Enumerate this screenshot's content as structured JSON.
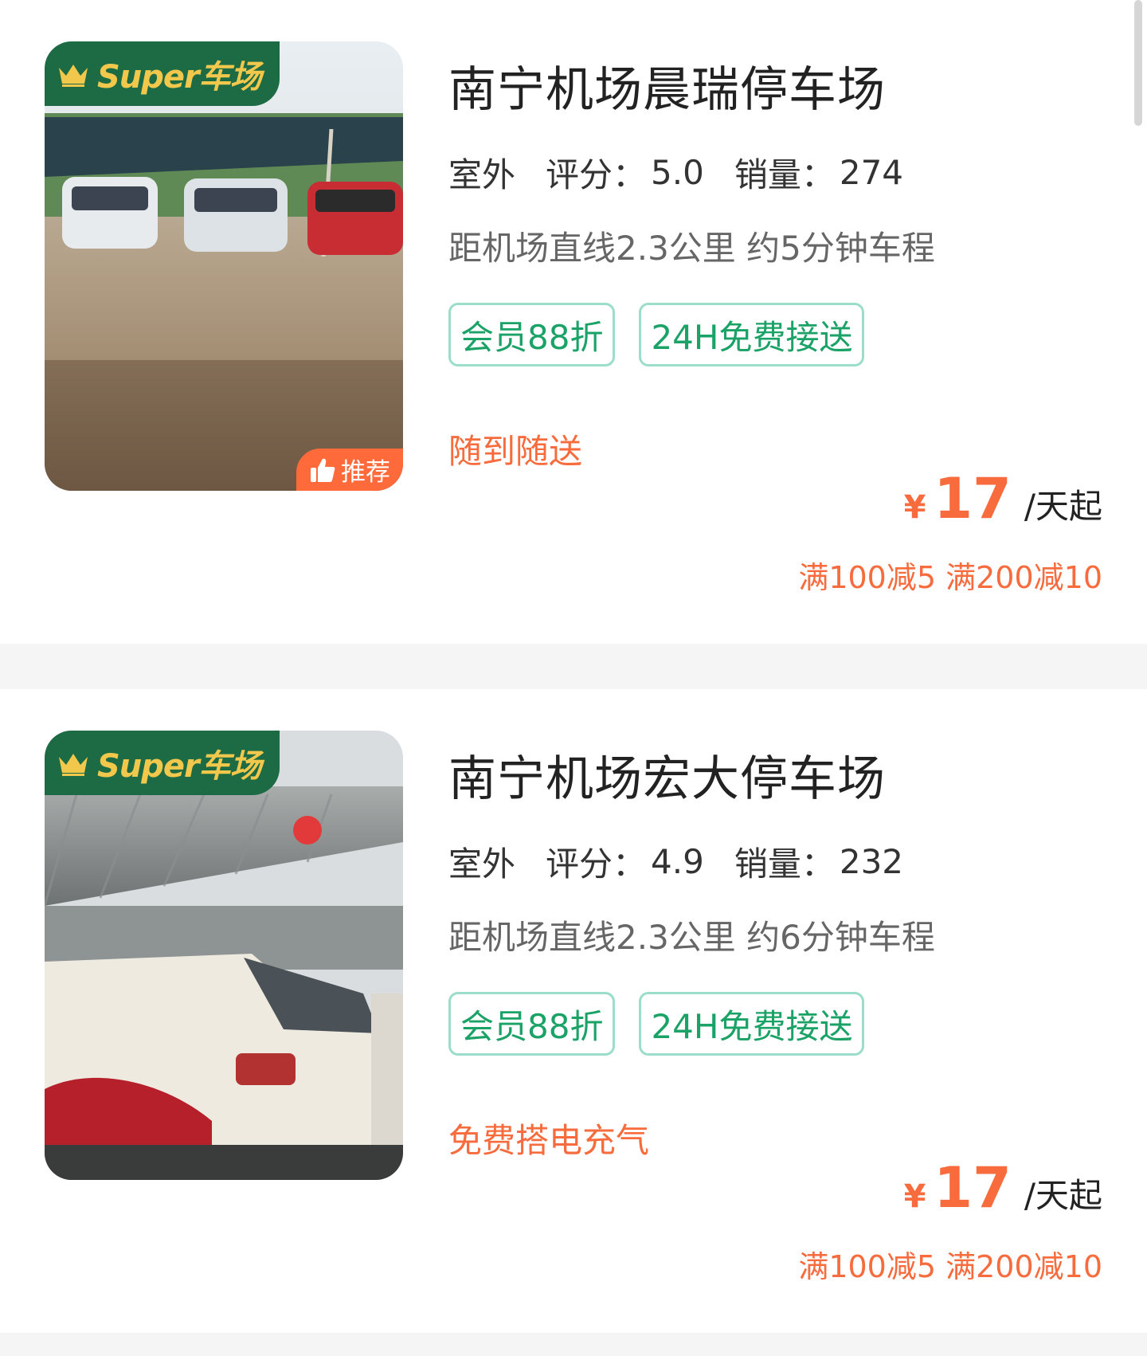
{
  "listings": [
    {
      "title": "南宁机场晨瑞停车场",
      "environment": "室外",
      "rating_label": "评分：",
      "rating": "5.0",
      "sales_label": "销量：",
      "sales": "274",
      "distance": "距机场直线2.3公里 约5分钟车程",
      "tags": [
        "会员88折",
        "24H免费接送"
      ],
      "service": "随到随送",
      "currency": "¥",
      "price": "17",
      "price_unit": "/天起",
      "promo": "满100减5 满200减10",
      "badge": "Super车场",
      "recommend": "推荐"
    },
    {
      "title": "南宁机场宏大停车场",
      "environment": "室外",
      "rating_label": "评分：",
      "rating": "4.9",
      "sales_label": "销量：",
      "sales": "232",
      "distance": "距机场直线2.3公里 约6分钟车程",
      "tags": [
        "会员88折",
        "24H免费接送"
      ],
      "service": "免费搭电充气",
      "currency": "¥",
      "price": "17",
      "price_unit": "/天起",
      "promo": "满100减5 满200减10",
      "badge": "Super车场"
    }
  ],
  "colors": {
    "accent_orange": "#f76b3c",
    "tag_green": "#1ba267",
    "badge_green": "#1d6b45",
    "badge_gold": "#f1c84b"
  },
  "icons": [
    "crown-icon",
    "thumbs-up-icon"
  ]
}
